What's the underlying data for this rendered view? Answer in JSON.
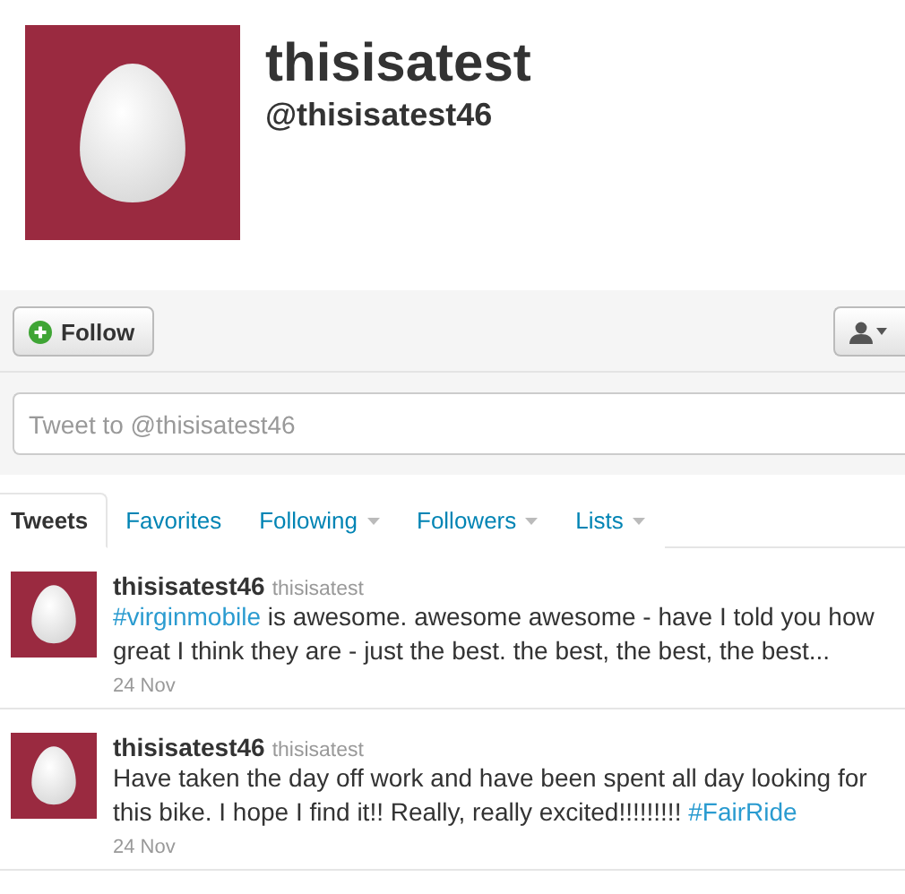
{
  "profile": {
    "name": "thisisatest",
    "handle": "@thisisatest46"
  },
  "actions": {
    "follow_label": "Follow"
  },
  "tweet_box": {
    "placeholder": "Tweet to @thisisatest46"
  },
  "tabs": [
    {
      "label": "Tweets",
      "selected": true,
      "has_menu": false
    },
    {
      "label": "Favorites",
      "selected": false,
      "has_menu": false
    },
    {
      "label": "Following",
      "selected": false,
      "has_menu": true
    },
    {
      "label": "Followers",
      "selected": false,
      "has_menu": true
    },
    {
      "label": "Lists",
      "selected": false,
      "has_menu": true
    }
  ],
  "tweets": [
    {
      "name": "thisisatest46",
      "username": "thisisatest",
      "segments": [
        {
          "kind": "hashtag",
          "text": "#virginmobile"
        },
        {
          "kind": "text",
          "text": " is awesome. awesome awesome - have I told you how great I think they are - just the best. the best, the best, the best..."
        }
      ],
      "date": "24 Nov"
    },
    {
      "name": "thisisatest46",
      "username": "thisisatest",
      "segments": [
        {
          "kind": "text",
          "text": "Have taken the day off work and have been spent all day looking for this bike. I hope I find it!! Really, really excited!!!!!!!!! "
        },
        {
          "kind": "hashtag",
          "text": "#FairRide"
        }
      ],
      "date": "24 Nov"
    }
  ]
}
